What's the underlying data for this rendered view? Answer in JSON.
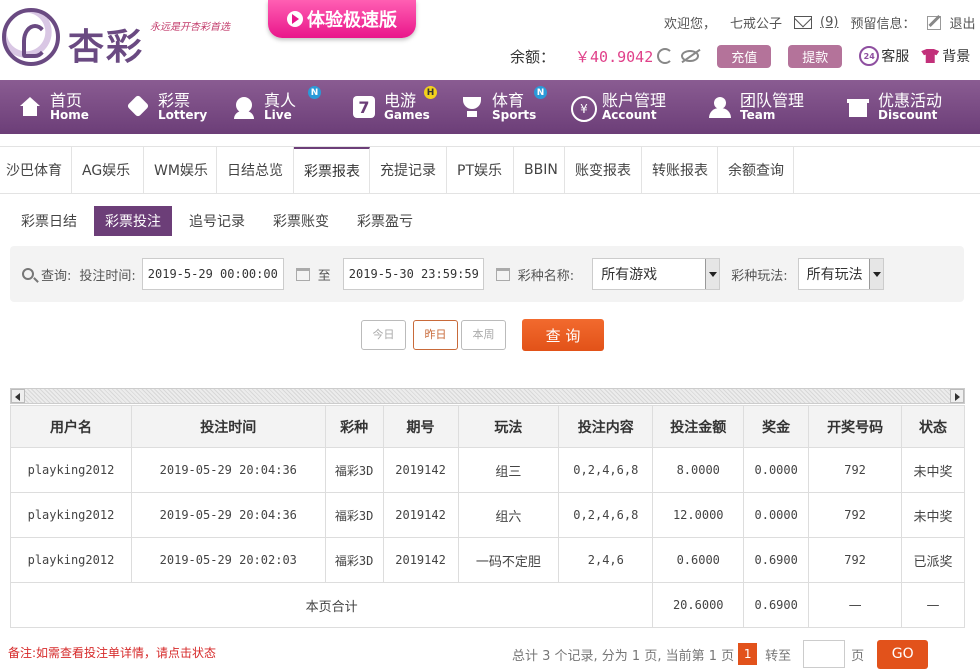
{
  "brand": {
    "name": "杏彩",
    "slogan": "永远是开杏彩首选",
    "experience_btn": "体验极速版"
  },
  "user": {
    "welcome": "欢迎您，",
    "username": "七戒公子",
    "msg_count": "(9)",
    "alert_label": "预留信息：",
    "balance_label": "余额：",
    "balance": "￥40.9042",
    "deposit": "充值",
    "withdraw": "提款",
    "service": "客服",
    "service_badge": "24",
    "background": "背景"
  },
  "nav": [
    {
      "cn": "首页",
      "en": "Home",
      "icon": "home-icon",
      "badge": ""
    },
    {
      "cn": "彩票",
      "en": "Lottery",
      "icon": "lottery-icon",
      "badge": ""
    },
    {
      "cn": "真人",
      "en": "Live",
      "icon": "live-icon",
      "badge": "N"
    },
    {
      "cn": "电游",
      "en": "Games",
      "icon": "game-icon",
      "badge": "H"
    },
    {
      "cn": "体育",
      "en": "Sports",
      "icon": "sports-icon",
      "badge": "N"
    },
    {
      "cn": "账户管理",
      "en": "Account",
      "icon": "account-icon",
      "badge": ""
    },
    {
      "cn": "团队管理",
      "en": "Team",
      "icon": "team-icon",
      "badge": ""
    },
    {
      "cn": "优惠活动",
      "en": "Discount",
      "icon": "gift-icon",
      "badge": ""
    }
  ],
  "tabs": [
    "沙巴体育",
    "AG娱乐",
    "WM娱乐",
    "日结总览",
    "彩票报表",
    "充提记录",
    "PT娱乐",
    "BBIN",
    "账变报表",
    "转账报表",
    "余额查询"
  ],
  "active_tab": "彩票报表",
  "subtabs": [
    "彩票日结",
    "彩票投注",
    "追号记录",
    "彩票账变",
    "彩票盈亏"
  ],
  "active_subtab": "彩票投注",
  "query": {
    "label": "查询:",
    "time_label": "投注时间:",
    "start": "2019-5-29 00:00:00",
    "to": "至",
    "end": "2019-5-30 23:59:59",
    "game_label": "彩种名称:",
    "game_value": "所有游戏",
    "play_label": "彩种玩法:",
    "play_value": "所有玩法",
    "today": "今日",
    "yesterday": "昨日",
    "this_week": "本周",
    "submit": "查 询"
  },
  "table": {
    "headers": [
      "用户名",
      "投注时间",
      "彩种",
      "期号",
      "玩法",
      "投注内容",
      "投注金额",
      "奖金",
      "开奖号码",
      "状态"
    ],
    "rows": [
      [
        "playking2012",
        "2019-05-29 20:04:36",
        "福彩3D",
        "2019142",
        "组三",
        "0,2,4,6,8",
        "8.0000",
        "0.0000",
        "792",
        "未中奖"
      ],
      [
        "playking2012",
        "2019-05-29 20:04:36",
        "福彩3D",
        "2019142",
        "组六",
        "0,2,4,6,8",
        "12.0000",
        "0.0000",
        "792",
        "未中奖"
      ],
      [
        "playking2012",
        "2019-05-29 20:02:03",
        "福彩3D",
        "2019142",
        "一码不定胆",
        "2,4,6",
        "0.6000",
        "0.6900",
        "792",
        "已派奖"
      ]
    ],
    "summary": {
      "label": "本页合计",
      "amount": "20.6000",
      "bonus": "0.6900",
      "dash1": "—",
      "dash2": "—"
    }
  },
  "footer": {
    "note": "备注:如需查看投注单详情，请点击状态",
    "pager_text": "总计 3 个记录, 分为 1 页, 当前第 1 页",
    "current_page": "1",
    "goto": "转至",
    "page_unit": "页",
    "go": "GO"
  }
}
